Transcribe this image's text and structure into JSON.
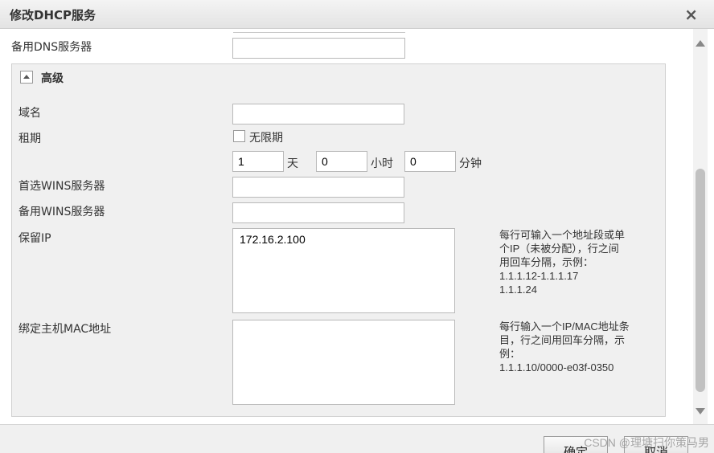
{
  "dialog": {
    "title": "修改DHCP服务",
    "close_label": "×"
  },
  "form": {
    "secondary_dns_label": "备用DNS服务器",
    "secondary_dns_value": ""
  },
  "advanced": {
    "title": "高级",
    "domain_label": "域名",
    "domain_value": "",
    "lease_label": "租期",
    "unlimited_label": "无限期",
    "days_value": "1",
    "days_unit": "天",
    "hours_value": "0",
    "hours_unit": "小时",
    "minutes_value": "0",
    "minutes_unit": "分钟",
    "primary_wins_label": "首选WINS服务器",
    "primary_wins_value": "",
    "secondary_wins_label": "备用WINS服务器",
    "secondary_wins_value": "",
    "reserved_ip_label": "保留IP",
    "reserved_ip_value": "172.16.2.100",
    "reserved_ip_hint": [
      "每行可输入一个地址段或单",
      "个IP（未被分配），行之间",
      "用回车分隔，示例：",
      "1.1.1.12-1.1.1.17",
      "1.1.1.24"
    ],
    "bind_mac_label": "绑定主机MAC地址",
    "bind_mac_value": "",
    "bind_mac_hint": [
      "每行输入一个IP/MAC地址条",
      "目，行之间用回车分隔，示",
      "例：",
      "1.1.1.10/0000-e03f-0350"
    ]
  },
  "footer": {
    "confirm_label": "确定",
    "cancel_label": "取消",
    "watermark": "CSDN @理塘扫你策马男"
  }
}
